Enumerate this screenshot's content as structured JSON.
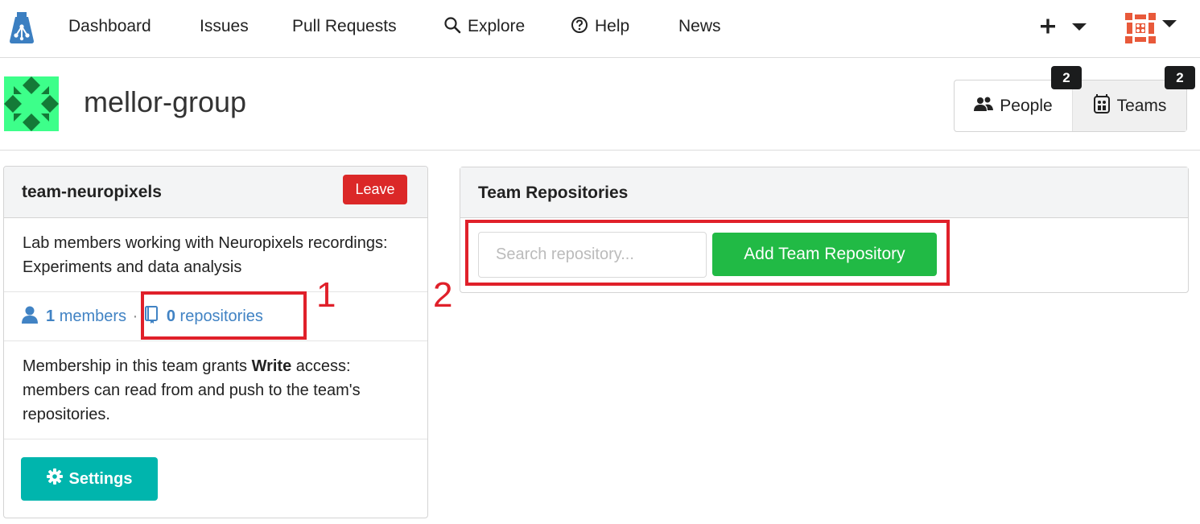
{
  "nav": {
    "items": [
      "Dashboard",
      "Issues",
      "Pull Requests",
      "Explore",
      "Help",
      "News"
    ],
    "plus_icon": "plus-icon",
    "avatar_icon": "user-avatar"
  },
  "org": {
    "name": "mellor-group",
    "tabs": [
      {
        "label": "People",
        "count": "2",
        "icon": "people-icon"
      },
      {
        "label": "Teams",
        "count": "2",
        "icon": "teams-icon"
      }
    ]
  },
  "team": {
    "name": "team-neuropixels",
    "leave_label": "Leave",
    "description": "Lab members working with Neuropixels recordings: Experiments and data analysis",
    "members_count": "1",
    "members_label": "members",
    "repos_count": "0",
    "repos_label": "repositories",
    "access_prefix": "Membership in this team grants ",
    "access_level": "Write",
    "access_suffix": " access: members can read from and push to the team's repositories.",
    "settings_label": "Settings"
  },
  "repos": {
    "title": "Team Repositories",
    "search_placeholder": "Search repository...",
    "add_label": "Add Team Repository"
  },
  "annotations": {
    "label_1": "1",
    "label_2": "2",
    "color": "#e0202a"
  },
  "colors": {
    "leave": "#db2828",
    "settings": "#00b5ad",
    "add_repo": "#21ba45",
    "link": "#4183c4"
  }
}
